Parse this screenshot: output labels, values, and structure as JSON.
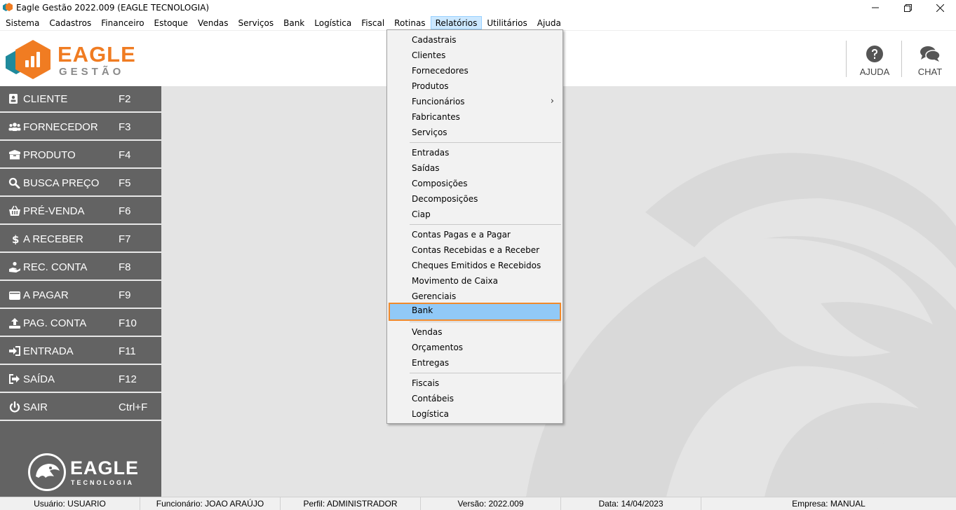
{
  "window": {
    "title": "Eagle Gestão 2022.009 (EAGLE TECNOLOGIA)"
  },
  "menubar": [
    "Sistema",
    "Cadastros",
    "Financeiro",
    "Estoque",
    "Vendas",
    "Serviços",
    "Bank",
    "Logística",
    "Fiscal",
    "Rotinas",
    "Relatórios",
    "Utilitários",
    "Ajuda"
  ],
  "menubar_active": "Relatórios",
  "logo": {
    "word": "EAGLE",
    "sub": "GESTÃO"
  },
  "header_buttons": {
    "help": "AJUDA",
    "chat": "CHAT"
  },
  "sidebar": [
    {
      "label": "CLIENTE",
      "key": "F2",
      "icon": "contact-card-icon"
    },
    {
      "label": "FORNECEDOR",
      "key": "F3",
      "icon": "users-icon"
    },
    {
      "label": "PRODUTO",
      "key": "F4",
      "icon": "box-icon"
    },
    {
      "label": "BUSCA PREÇO",
      "key": "F5",
      "icon": "search-icon"
    },
    {
      "label": "PRÉ-VENDA",
      "key": "F6",
      "icon": "basket-icon"
    },
    {
      "label": "A RECEBER",
      "key": "F7",
      "icon": "dollar-icon"
    },
    {
      "label": "REC. CONTA",
      "key": "F8",
      "icon": "hand-coin-icon"
    },
    {
      "label": "A PAGAR",
      "key": "F9",
      "icon": "wallet-icon"
    },
    {
      "label": "PAG. CONTA",
      "key": "F10",
      "icon": "upload-icon"
    },
    {
      "label": "ENTRADA",
      "key": "F11",
      "icon": "sign-in-icon"
    },
    {
      "label": "SAÍDA",
      "key": "F12",
      "icon": "sign-out-icon"
    },
    {
      "label": "SAIR",
      "key": "Ctrl+F",
      "icon": "power-icon"
    }
  ],
  "sidebar_logo": {
    "word": "EAGLE",
    "sub": "TECNOLOGIA"
  },
  "relatorios_menu": {
    "groups": [
      [
        {
          "label": "Cadastrais"
        },
        {
          "label": "Clientes"
        },
        {
          "label": "Fornecedores"
        },
        {
          "label": "Produtos"
        },
        {
          "label": "Funcionários",
          "submenu": true
        },
        {
          "label": "Fabricantes"
        },
        {
          "label": "Serviços"
        }
      ],
      [
        {
          "label": "Entradas"
        },
        {
          "label": "Saídas"
        },
        {
          "label": "Composições"
        },
        {
          "label": "Decomposições"
        },
        {
          "label": "Ciap"
        }
      ],
      [
        {
          "label": "Contas Pagas e a Pagar"
        },
        {
          "label": "Contas Recebidas e a Receber"
        },
        {
          "label": "Cheques Emitidos e Recebidos"
        },
        {
          "label": "Movimento de Caixa"
        },
        {
          "label": "Gerenciais"
        },
        {
          "label": "Bank",
          "highlighted": true
        }
      ],
      [
        {
          "label": "Vendas"
        },
        {
          "label": "Orçamentos"
        },
        {
          "label": "Entregas"
        }
      ],
      [
        {
          "label": "Fiscais"
        },
        {
          "label": "Contábeis"
        },
        {
          "label": "Logística"
        }
      ]
    ]
  },
  "statusbar": [
    "Usuário: USUARIO",
    "Funcionário: JOAO ARAÚJO",
    "Perfil: ADMINISTRADOR",
    "Versão: 2022.009",
    "Data: 14/04/2023",
    "Empresa: MANUAL"
  ],
  "colors": {
    "accent": "#f07c22",
    "teal": "#1f8a9c",
    "sidebar": "#636363",
    "highlight": "#91c9f7",
    "highlight_border": "#f08a2c"
  }
}
